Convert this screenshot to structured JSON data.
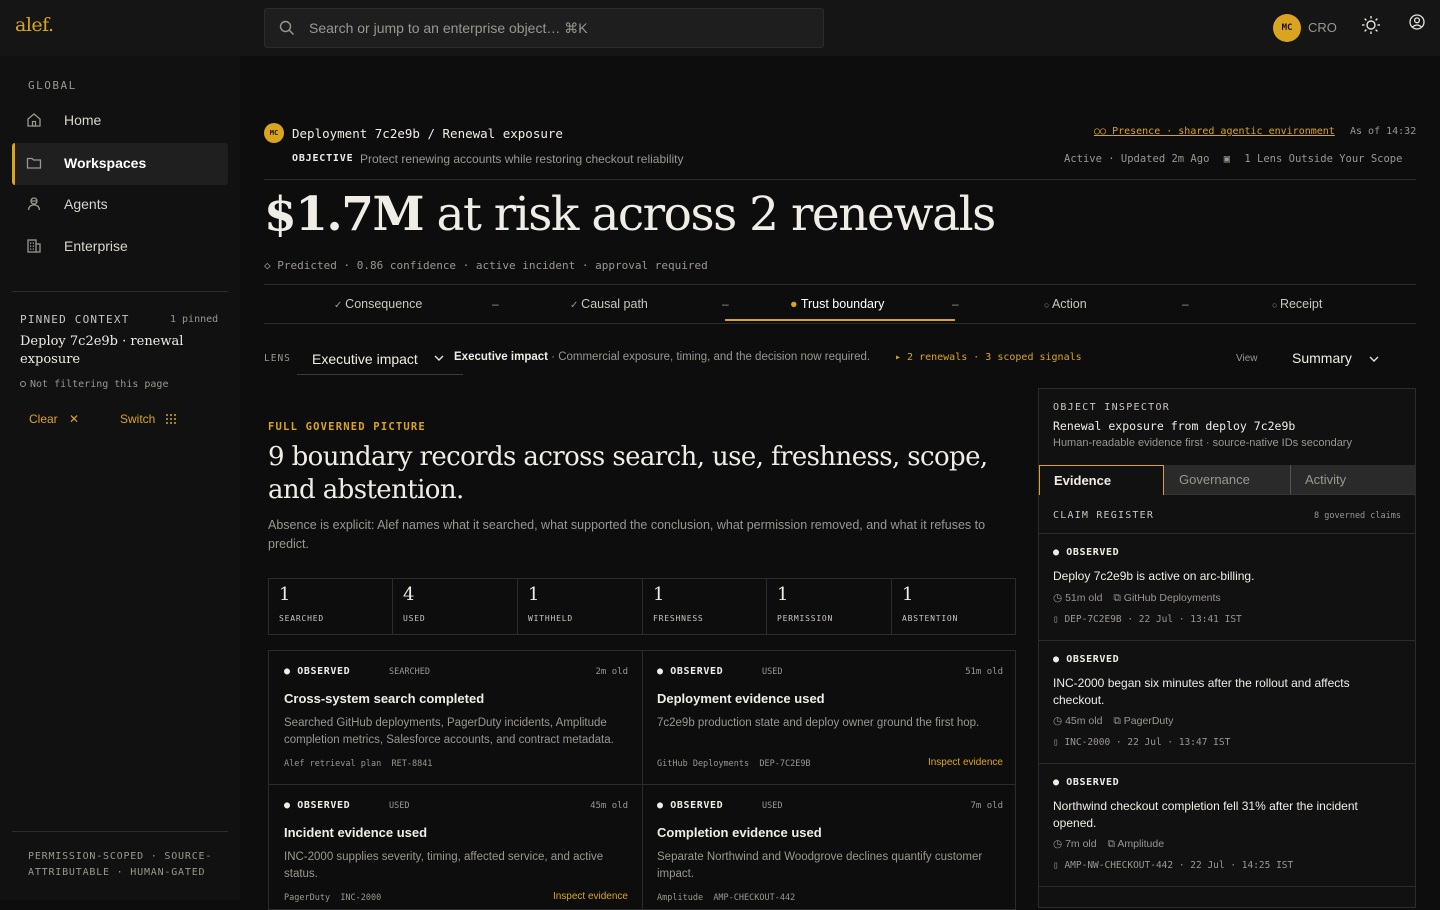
{
  "app": {
    "logo": "alef."
  },
  "search": {
    "placeholder": "Search or jump to an enterprise object… ⌘K"
  },
  "user": {
    "initials": "MC",
    "role": "CRO"
  },
  "sidebar": {
    "section_label": "GLOBAL",
    "items": [
      {
        "label": "Home",
        "icon": "home-icon"
      },
      {
        "label": "Workspaces",
        "icon": "folder-icon",
        "active": true
      },
      {
        "label": "Agents",
        "icon": "agent-icon"
      },
      {
        "label": "Enterprise",
        "icon": "building-icon"
      }
    ],
    "pinned": {
      "label": "PINNED CONTEXT",
      "count": "1 pinned",
      "title": "Deploy 7c2e9b · renewal exposure",
      "status": "Not filtering this page",
      "clear": "Clear",
      "switch": "Switch"
    },
    "footer": "PERMISSION-SCOPED · SOURCE-ATTRIBUTABLE · HUMAN-GATED"
  },
  "header": {
    "initials": "MC",
    "breadcrumb": "Deployment 7c2e9b / Renewal exposure",
    "presence": "Presence · shared agentic environment",
    "as_of": "As of 14:32",
    "objective_label": "OBJECTIVE",
    "objective": "Protect renewing accounts while restoring checkout reliability",
    "status": "Active · Updated 2m Ago",
    "scope": "1 Lens Outside Your Scope"
  },
  "headline": {
    "amount": "$1.7M",
    "rest": "at risk across 2 renewals",
    "meta": "Predicted · 0.86 confidence · active incident · approval required"
  },
  "stepper": {
    "steps": [
      {
        "label": "Consequence",
        "state": "done"
      },
      {
        "label": "Causal path",
        "state": "done"
      },
      {
        "label": "Trust boundary",
        "state": "active"
      },
      {
        "label": "Action",
        "state": "todo"
      },
      {
        "label": "Receipt",
        "state": "todo"
      }
    ],
    "sep": "–"
  },
  "lens": {
    "label": "LENS",
    "value": "Executive impact",
    "desc_bold": "Executive impact",
    "desc": "· Commercial exposure, timing, and the decision now required.",
    "signals": "▸ 2 renewals · 3 scoped signals",
    "view_label": "View",
    "view_value": "Summary"
  },
  "picture": {
    "eyebrow": "FULL GOVERNED PICTURE",
    "title": "9 boundary records across search, use, freshness, scope, and abstention.",
    "desc": "Absence is explicit: Alef names what it searched, what supported the conclusion, what permission removed, and what it refuses to predict.",
    "stats": [
      {
        "value": "1",
        "label": "SEARCHED"
      },
      {
        "value": "4",
        "label": "USED"
      },
      {
        "value": "1",
        "label": "WITHHELD"
      },
      {
        "value": "1",
        "label": "FRESHNESS"
      },
      {
        "value": "1",
        "label": "PERMISSION"
      },
      {
        "value": "1",
        "label": "ABSTENTION"
      }
    ],
    "cards": [
      {
        "state": "OBSERVED",
        "kind": "SEARCHED",
        "age": "2m old",
        "title": "Cross-system search completed",
        "body": "Searched GitHub deployments, PagerDuty incidents, Amplitude completion metrics, Salesforce accounts, and contract metadata.",
        "source": "Alef retrieval plan",
        "id": "RET-8841",
        "link": ""
      },
      {
        "state": "OBSERVED",
        "kind": "USED",
        "age": "51m old",
        "title": "Deployment evidence used",
        "body": "7c2e9b production state and deploy owner ground the first hop.",
        "source": "GitHub Deployments",
        "id": "DEP-7C2E9B",
        "link": "Inspect evidence"
      },
      {
        "state": "OBSERVED",
        "kind": "USED",
        "age": "45m old",
        "title": "Incident evidence used",
        "body": "INC-2000 supplies severity, timing, affected service, and active status.",
        "source": "PagerDuty",
        "id": "INC-2000",
        "link": "Inspect evidence"
      },
      {
        "state": "OBSERVED",
        "kind": "USED",
        "age": "7m old",
        "title": "Completion evidence used",
        "body": "Separate Northwind and Woodgrove declines quantify customer impact.",
        "source": "Amplitude",
        "id": "AMP-CHECKOUT-442",
        "link": ""
      }
    ]
  },
  "inspector": {
    "label": "OBJECT INSPECTOR",
    "title": "Renewal exposure from deploy 7c2e9b",
    "subtitle": "Human-readable evidence first · source-native IDs secondary",
    "tabs": [
      "Evidence",
      "Governance",
      "Activity"
    ],
    "register_label": "CLAIM REGISTER",
    "register_count": "8 governed claims",
    "claims": [
      {
        "state": "OBSERVED",
        "text": "Deploy 7c2e9b is active on arc-billing.",
        "age": "51m old",
        "source": "GitHub Deployments",
        "ref": "DEP-7C2E9B · 22 Jul · 13:41 IST"
      },
      {
        "state": "OBSERVED",
        "text": "INC-2000 began six minutes after the rollout and affects checkout.",
        "age": "45m old",
        "source": "PagerDuty",
        "ref": "INC-2000 · 22 Jul · 13:47 IST"
      },
      {
        "state": "OBSERVED",
        "text": "Northwind checkout completion fell 31% after the incident opened.",
        "age": "7m old",
        "source": "Amplitude",
        "ref": "AMP-NW-CHECKOUT-442 · 22 Jul · 14:25 IST"
      }
    ]
  },
  "colors": {
    "accent": "#d9a520",
    "bg": "#0d0d0d",
    "panel": "#151515"
  }
}
